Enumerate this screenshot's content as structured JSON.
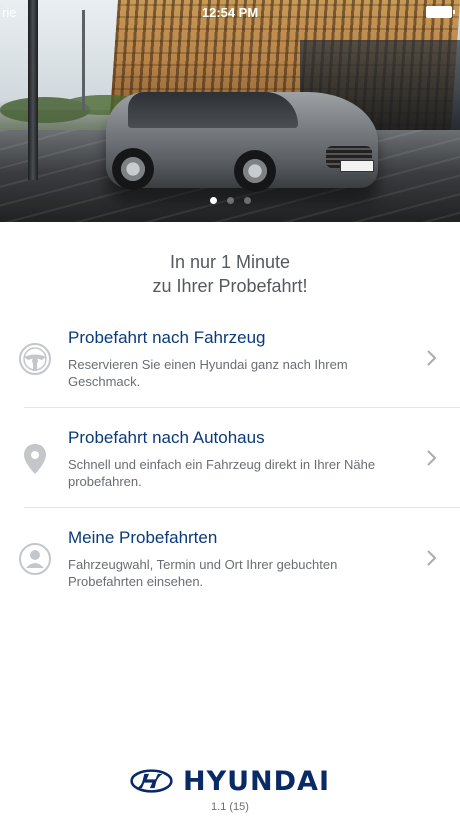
{
  "status_bar": {
    "carrier": "rie",
    "time": "12:54 PM"
  },
  "carousel": {
    "page_count": 3,
    "active_index": 0
  },
  "headline": {
    "line1": "In nur 1 Minute",
    "line2": "zu Ihrer Probefahrt!"
  },
  "menu": [
    {
      "icon": "steering-wheel-icon",
      "title": "Probefahrt nach Fahrzeug",
      "description_line1": "Reservieren Sie einen Hyundai ganz nach Ihrem",
      "description_line2": "Geschmack."
    },
    {
      "icon": "location-pin-icon",
      "title": "Probefahrt nach Autohaus",
      "description_line1": "Schnell und einfach ein Fahrzeug direkt in Ihrer Nähe",
      "description_line2": "probefahren."
    },
    {
      "icon": "user-icon",
      "title": "Meine Probefahrten",
      "description_line1": "Fahrzeugwahl, Termin und Ort Ihrer gebuchten",
      "description_line2": "Probefahrten einsehen."
    }
  ],
  "brand": {
    "name": "HYUNDAI",
    "color": "#0a2a66"
  },
  "version": "1.1 (15)",
  "colors": {
    "title": "#0a3a7a",
    "text": "#6a6e72",
    "icon": "#c4c7ca"
  }
}
